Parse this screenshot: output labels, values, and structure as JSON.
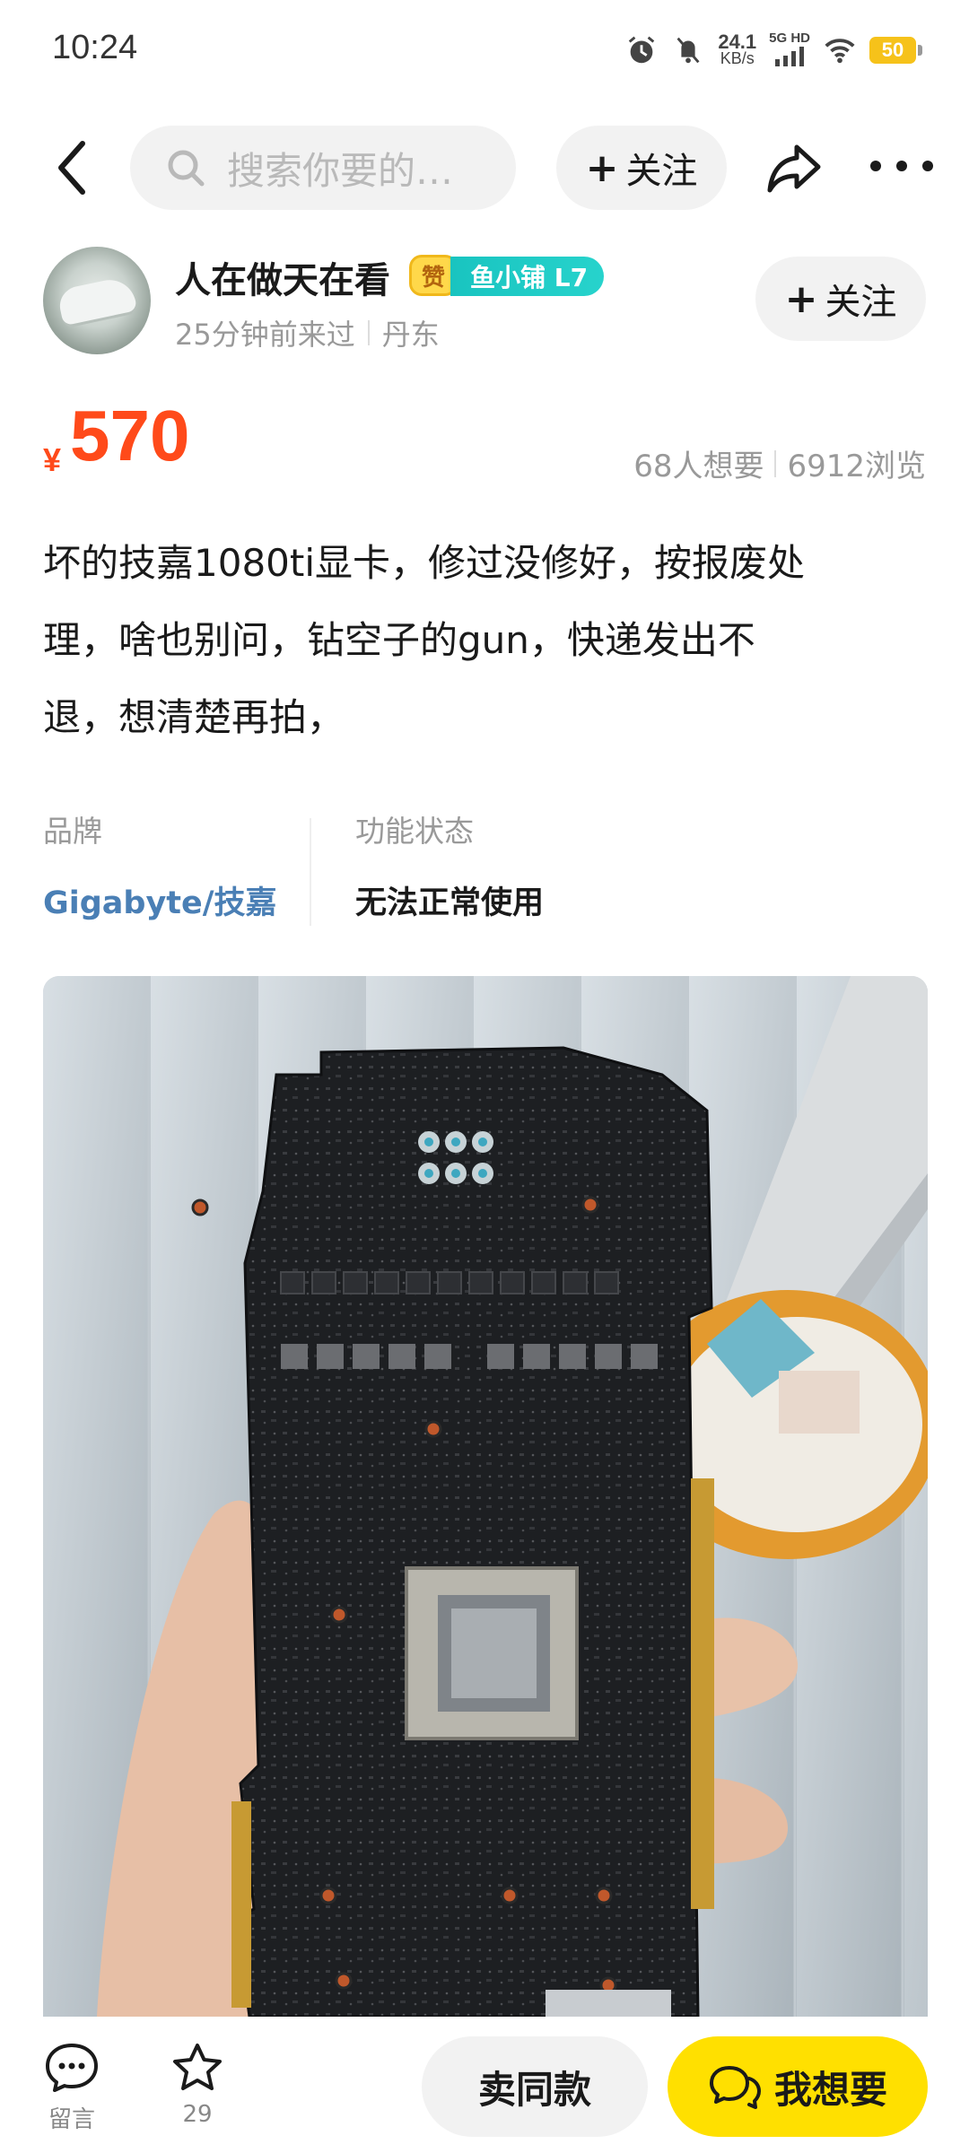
{
  "status_bar": {
    "time": "10:24",
    "net_speed_value": "24.1",
    "net_speed_unit": "KB/s",
    "network": "5G HD",
    "battery": "50",
    "icons": [
      "alarm-icon",
      "mute-icon",
      "signal-icon",
      "wifi-icon",
      "battery-icon"
    ]
  },
  "top_nav": {
    "search_placeholder": "搜索你要的…",
    "follow_label": "关注",
    "icons": [
      "back-icon",
      "search-icon",
      "share-icon",
      "more-icon"
    ]
  },
  "seller": {
    "name": "人在做天在看",
    "zan_badge": "赞",
    "shop_badge": "鱼小铺 L7",
    "last_seen": "25分钟前来过",
    "location": "丹东",
    "follow_label": "关注"
  },
  "price": {
    "symbol": "¥",
    "value": "570",
    "want_count": "68人想要",
    "views": "6912浏览"
  },
  "description": {
    "lines": [
      "坏的技嘉1080ti显卡，修过没修好，按报废处",
      "理，啥也别问，钻空子的gun，快递发出不",
      "退，想清楚再拍，"
    ]
  },
  "attributes": [
    {
      "label": "品牌",
      "value": "Gigabyte/技嘉"
    },
    {
      "label": "功能状态",
      "value": "无法正常使用"
    }
  ],
  "bottom_bar": {
    "comment_label": "留言",
    "favorite_count": "29",
    "same_label": "卖同款",
    "want_label": "我想要"
  },
  "colors": {
    "price": "#ff4a1a",
    "accent_yellow": "#ffe000",
    "brand_link": "#4a7fb5",
    "shop_badge": "#19c4c0"
  }
}
